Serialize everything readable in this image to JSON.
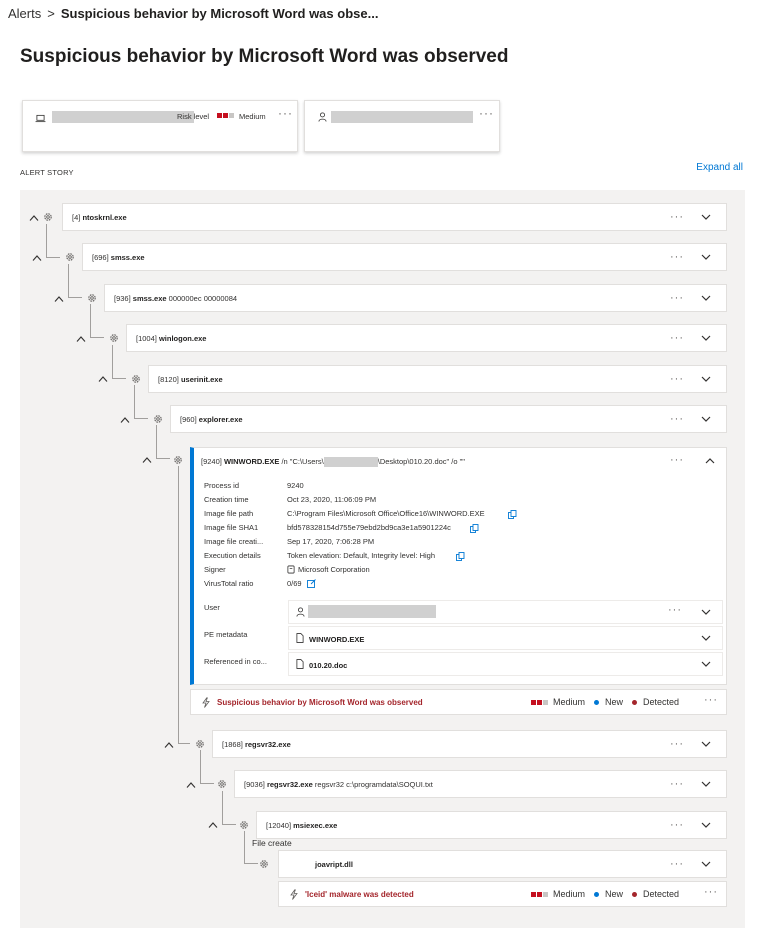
{
  "breadcrumb": {
    "root": "Alerts",
    "separator": ">",
    "current": "Suspicious behavior by Microsoft Word was obse..."
  },
  "page_title": "Suspicious behavior by Microsoft Word was observed",
  "device_card": {
    "risk_label": "Risk level",
    "risk_value": "Medium",
    "more": "···"
  },
  "user_card": {
    "more": "···"
  },
  "alert_story": {
    "label": "ALERT STORY",
    "expand_all": "Expand all"
  },
  "processes": [
    {
      "pid": "[4]",
      "name": "ntoskrnl.exe",
      "args": ""
    },
    {
      "pid": "[696]",
      "name": "smss.exe",
      "args": ""
    },
    {
      "pid": "[936]",
      "name": "smss.exe",
      "args": "000000ec 00000084"
    },
    {
      "pid": "[1004]",
      "name": "winlogon.exe",
      "args": ""
    },
    {
      "pid": "[8120]",
      "name": "userinit.exe",
      "args": ""
    },
    {
      "pid": "[960]",
      "name": "explorer.exe",
      "args": ""
    },
    {
      "pid": "[9240]",
      "name": "WINWORD.EXE",
      "args_prefix": "/n \"C:\\Users\\",
      "args_suffix": "\\Desktop\\010.20.doc\" /o \"\""
    },
    {
      "pid": "[1868]",
      "name": "regsvr32.exe",
      "args": ""
    },
    {
      "pid": "[9036]",
      "name": "regsvr32.exe",
      "args": "regsvr32 c:\\programdata\\SOQUI.txt"
    },
    {
      "pid": "[12040]",
      "name": "msiexec.exe",
      "args": ""
    }
  ],
  "winword_details": {
    "rows": [
      {
        "key": "Process id",
        "value": "9240"
      },
      {
        "key": "Creation time",
        "value": "Oct 23, 2020, 11:06:09 PM"
      },
      {
        "key": "Image file path",
        "value": "C:\\Program Files\\Microsoft Office\\Office16\\WINWORD.EXE"
      },
      {
        "key": "Image file SHA1",
        "value": "bfd578328154d755e79ebd2bd9ca3e1a5901224c"
      },
      {
        "key": "Image file creati...",
        "value": "Sep 17, 2020, 7:06:28 PM"
      },
      {
        "key": "Execution details",
        "value": "Token elevation: Default, Integrity level: High"
      },
      {
        "key": "Signer",
        "value": "Microsoft Corporation"
      },
      {
        "key": "VirusTotal ratio",
        "value": "0/69"
      }
    ],
    "user_label": "User",
    "pe_label": "PE metadata",
    "pe_value": "WINWORD.EXE",
    "ref_label": "Referenced in co...",
    "ref_value": "010.20.doc"
  },
  "alerts": [
    {
      "title": "Suspicious behavior by Microsoft Word was observed",
      "severity": "Medium",
      "status": "New",
      "detection": "Detected"
    },
    {
      "title": "'Iceid' malware was detected",
      "severity": "Medium",
      "status": "New",
      "detection": "Detected"
    }
  ],
  "file_create": {
    "label": "File create",
    "file": "joavript.dll"
  },
  "more": "···",
  "colors": {
    "accent": "#0078d4",
    "severity": "#c50f1f",
    "alert_title": "#a4262c",
    "detected": "#a4262c",
    "new": "#0078d4"
  }
}
